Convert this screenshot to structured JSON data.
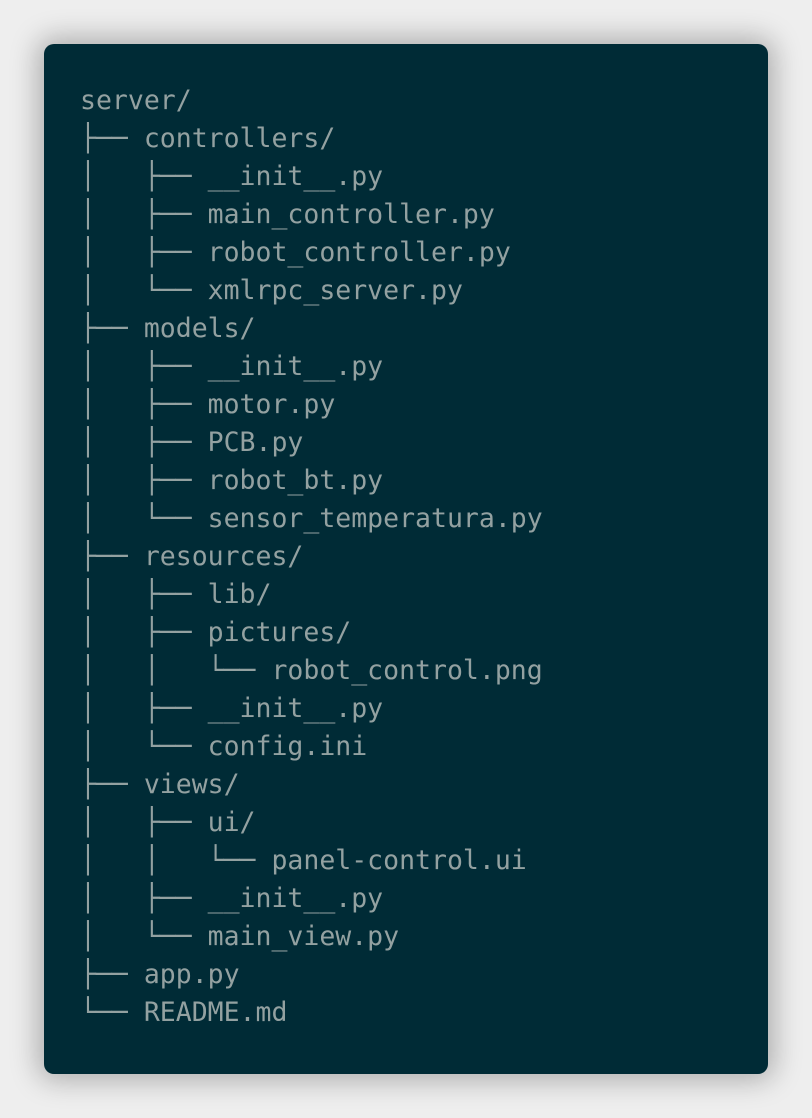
{
  "lines": [
    {
      "prefix": "",
      "name": "server/"
    },
    {
      "prefix": "├── ",
      "name": "controllers/"
    },
    {
      "prefix": "│   ├── ",
      "name": "__init__.py"
    },
    {
      "prefix": "│   ├── ",
      "name": "main_controller.py"
    },
    {
      "prefix": "│   ├── ",
      "name": "robot_controller.py"
    },
    {
      "prefix": "│   └── ",
      "name": "xmlrpc_server.py"
    },
    {
      "prefix": "├── ",
      "name": "models/"
    },
    {
      "prefix": "│   ├── ",
      "name": "__init__.py"
    },
    {
      "prefix": "│   ├── ",
      "name": "motor.py"
    },
    {
      "prefix": "│   ├── ",
      "name": "PCB.py"
    },
    {
      "prefix": "│   ├── ",
      "name": "robot_bt.py"
    },
    {
      "prefix": "│   └── ",
      "name": "sensor_temperatura.py"
    },
    {
      "prefix": "├── ",
      "name": "resources/"
    },
    {
      "prefix": "│   ├── ",
      "name": "lib/"
    },
    {
      "prefix": "│   ├── ",
      "name": "pictures/"
    },
    {
      "prefix": "│   │   └── ",
      "name": "robot_control.png"
    },
    {
      "prefix": "│   ├── ",
      "name": "__init__.py"
    },
    {
      "prefix": "│   └── ",
      "name": "config.ini"
    },
    {
      "prefix": "├── ",
      "name": "views/"
    },
    {
      "prefix": "│   ├── ",
      "name": "ui/"
    },
    {
      "prefix": "│   │   └── ",
      "name": "panel-control.ui"
    },
    {
      "prefix": "│   ├── ",
      "name": "__init__.py"
    },
    {
      "prefix": "│   └── ",
      "name": "main_view.py"
    },
    {
      "prefix": "├── ",
      "name": "app.py"
    },
    {
      "prefix": "└── ",
      "name": "README.md"
    }
  ]
}
